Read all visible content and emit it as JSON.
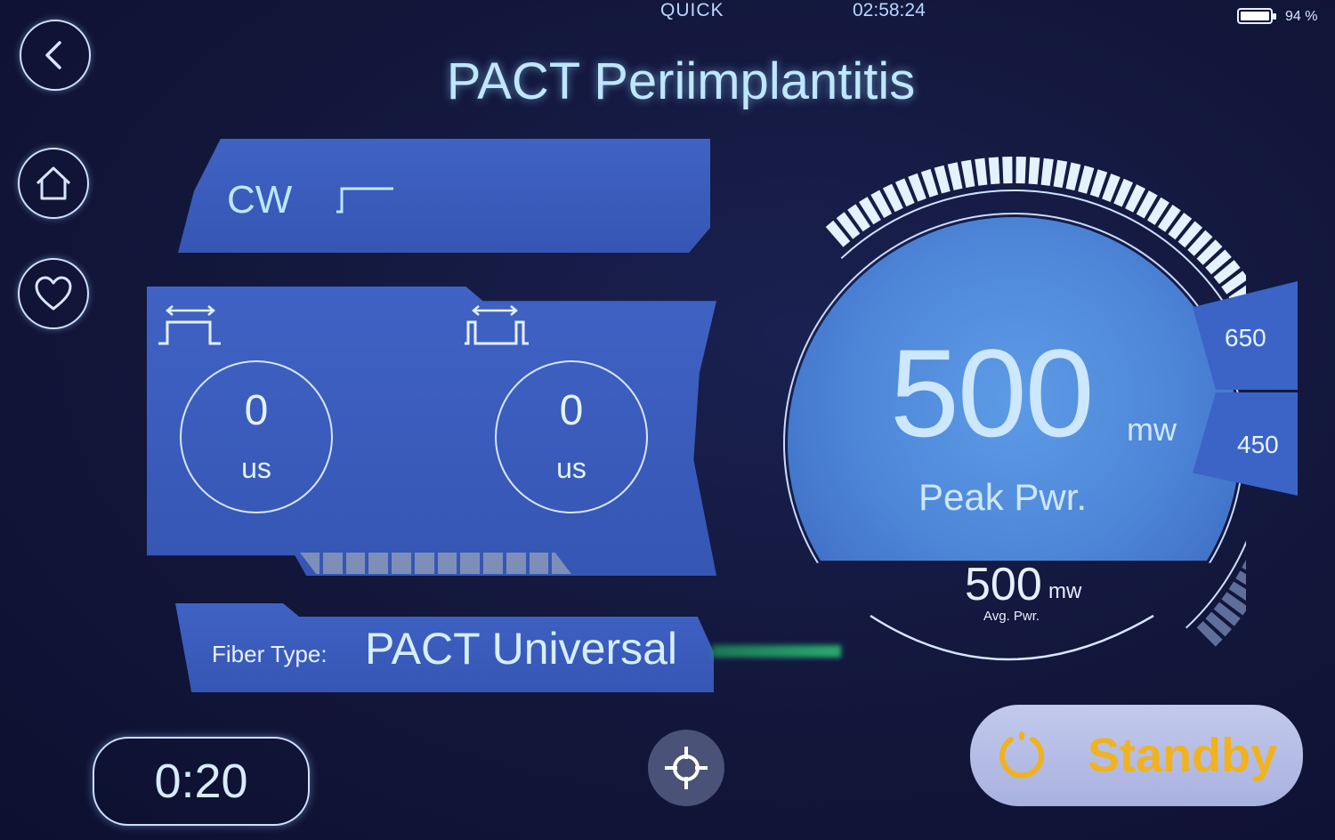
{
  "status_bar": {
    "mode": "QUICK",
    "time": "02:58:24",
    "battery_percent": "94 %",
    "battery_level": 0.94
  },
  "nav": {
    "back_icon": "chevron-left-icon",
    "home_icon": "home-icon",
    "favorite_icon": "heart-icon"
  },
  "title": "PACT Periimplantitis",
  "mode": {
    "label": "CW",
    "icon": "continuous-wave-icon"
  },
  "pulse": {
    "on_time": {
      "value": "0",
      "unit": "us",
      "icon": "pulse-width-icon"
    },
    "off_time": {
      "value": "0",
      "unit": "us",
      "icon": "pulse-interval-icon"
    }
  },
  "fiber": {
    "label": "Fiber Type:",
    "value": "PACT Universal"
  },
  "gauge": {
    "peak_value": "500",
    "peak_unit": "mw",
    "peak_label": "Peak Pwr.",
    "avg_value": "500",
    "avg_unit": "mw",
    "avg_label": "Avg. Pwr.",
    "upper_preset": "650",
    "lower_preset": "450",
    "level_fraction": 0.77
  },
  "timer": {
    "value": "0:20"
  },
  "aim": {
    "icon": "crosshair-icon"
  },
  "standby": {
    "label": "Standby",
    "icon": "power-icon",
    "color": "#f0b21e"
  },
  "colors": {
    "panel": "#3f62c4",
    "background": "#12163a",
    "glow": "#bfe7ff"
  }
}
